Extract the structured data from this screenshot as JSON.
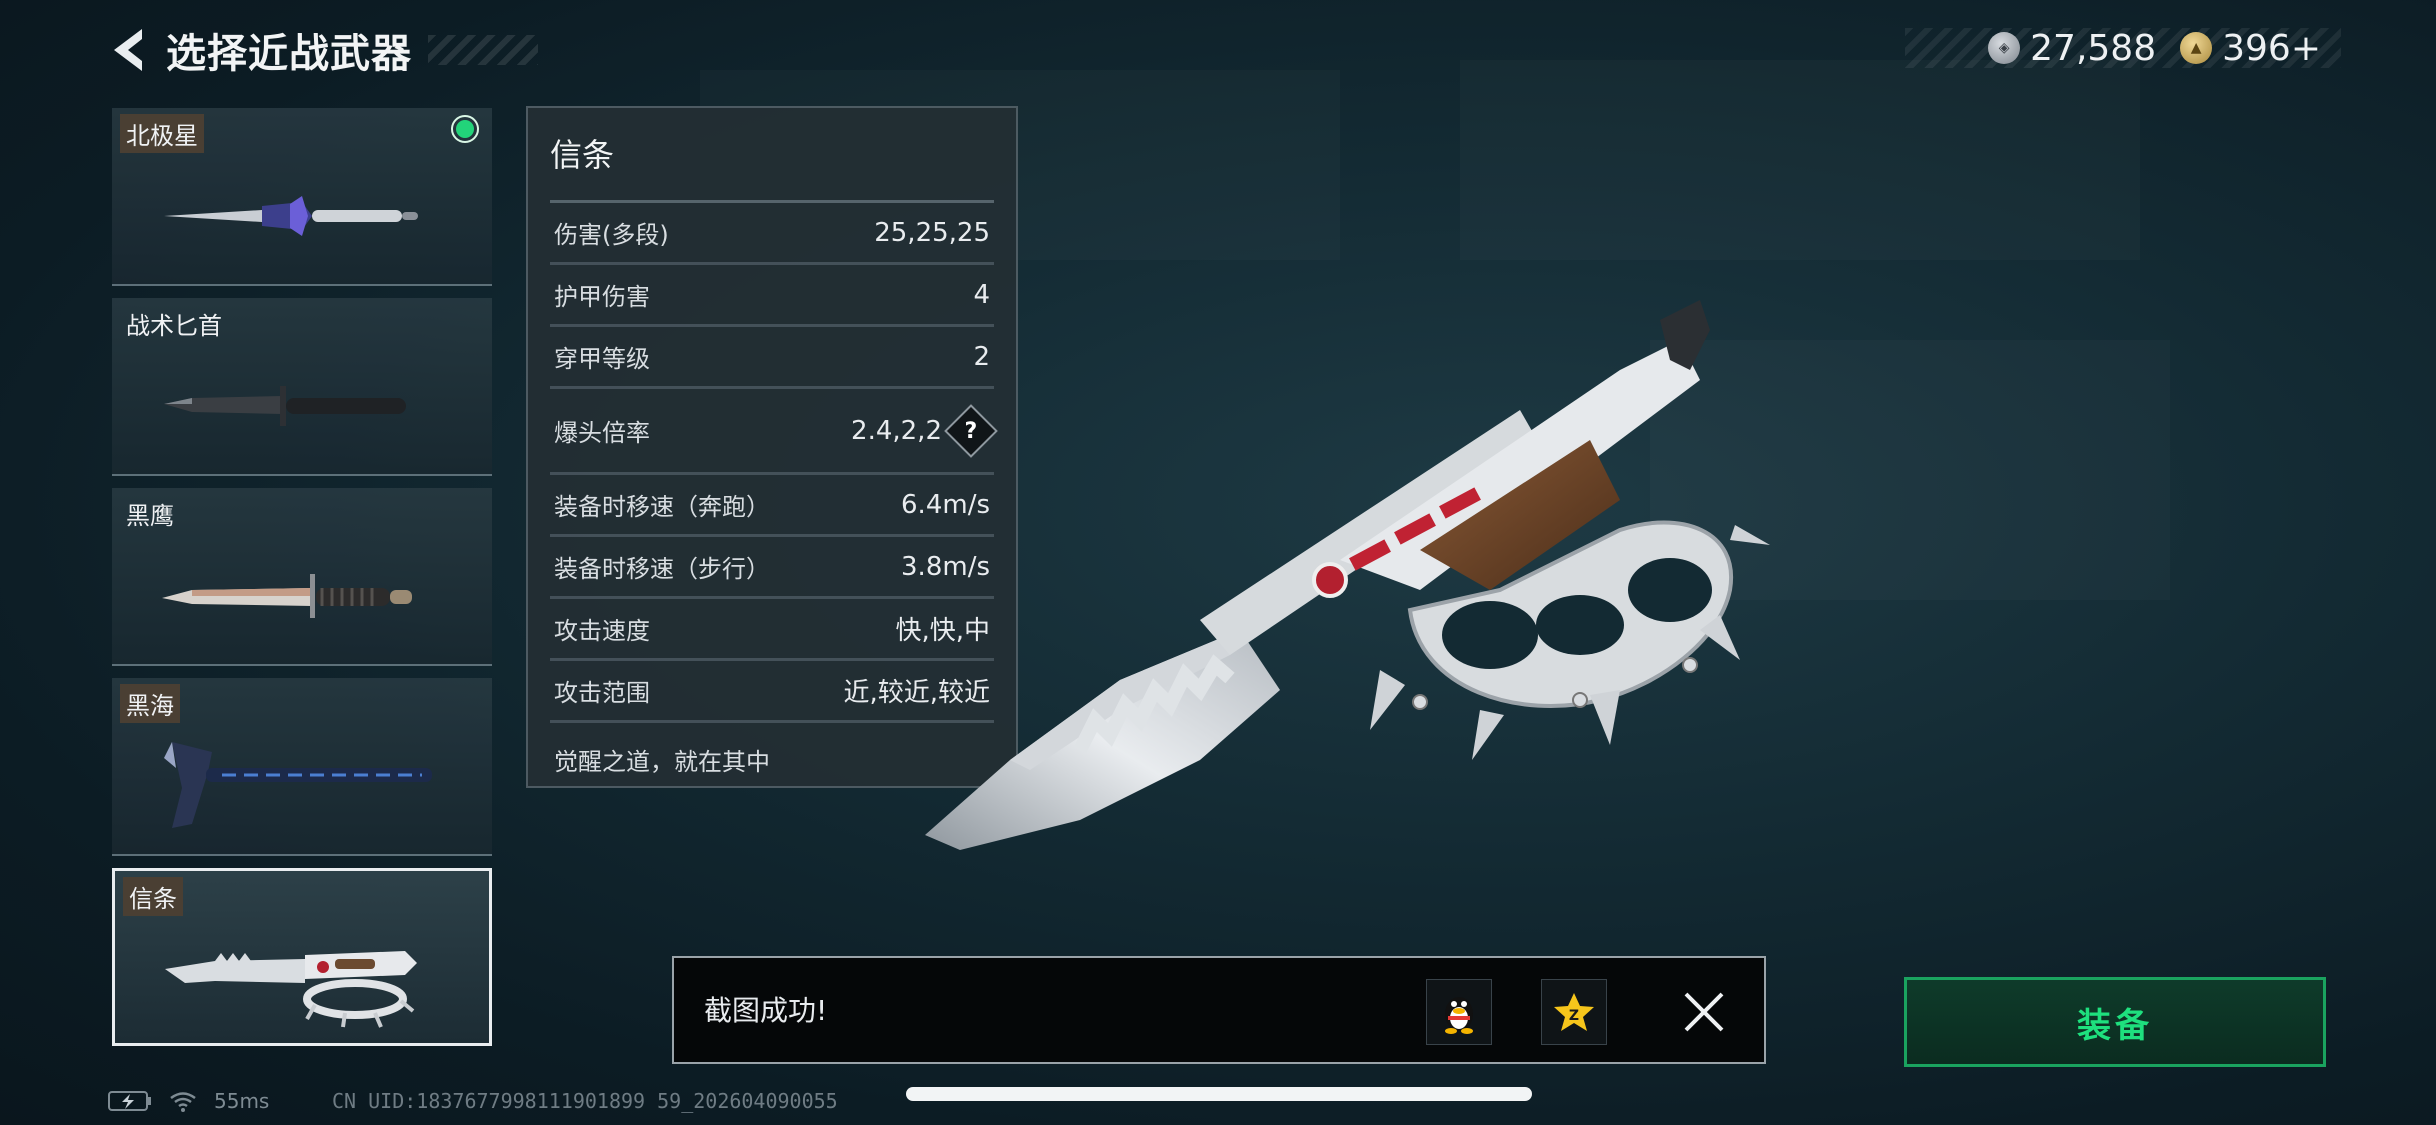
{
  "header": {
    "title": "选择近战武器"
  },
  "currency": [
    {
      "icon": "silver-coin-icon",
      "value": "27,588"
    },
    {
      "icon": "gold-coin-icon",
      "value": "396+"
    }
  ],
  "weapons": [
    {
      "name": "北极星",
      "equipped": true,
      "selected": false
    },
    {
      "name": "战术匕首",
      "equipped": false,
      "selected": false
    },
    {
      "name": "黑鹰",
      "equipped": false,
      "selected": false
    },
    {
      "name": "黑海",
      "equipped": false,
      "selected": false
    },
    {
      "name": "信条",
      "equipped": false,
      "selected": true
    }
  ],
  "stats": {
    "title": "信条",
    "rows": [
      {
        "label": "伤害(多段)",
        "value": "25,25,25"
      },
      {
        "label": "护甲伤害",
        "value": "4"
      },
      {
        "label": "穿甲等级",
        "value": "2"
      },
      {
        "label": "爆头倍率",
        "value": "2.4,2,2",
        "help": "?"
      },
      {
        "label": "装备时移速（奔跑）",
        "value": "6.4m/s"
      },
      {
        "label": "装备时移速（步行）",
        "value": "3.8m/s"
      },
      {
        "label": "攻击速度",
        "value": "快,快,中"
      },
      {
        "label": "攻击范围",
        "value": "近,较近,较近"
      }
    ],
    "description": "觉醒之道，就在其中"
  },
  "toast": {
    "message": "截图成功!"
  },
  "equip_button": {
    "label": "装备"
  },
  "status": {
    "ping": "55ms",
    "uid": "CN UID:1837677998111901899 59_202604090055"
  },
  "colors": {
    "accent_green": "#1ee07e",
    "equipped_dot": "#22d47a"
  }
}
